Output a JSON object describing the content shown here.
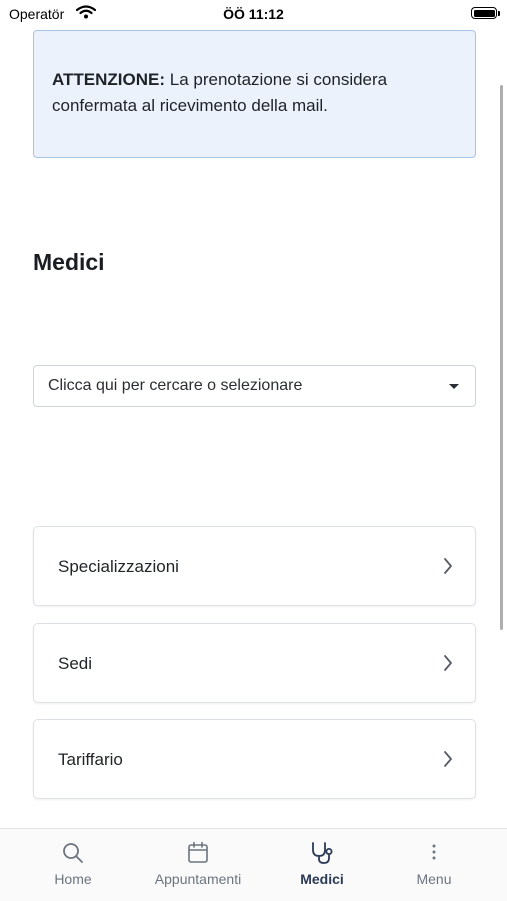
{
  "status_bar": {
    "carrier": "Operatör",
    "time": "ÖÖ 11:12"
  },
  "alert": {
    "title": "ATTENZIONE:",
    "message": "La prenotazione si considera confermata al ricevimento della mail."
  },
  "page": {
    "title": "Medici"
  },
  "search": {
    "placeholder": "Clicca qui per cercare o selezionare"
  },
  "menu": {
    "items": [
      {
        "label": "Specializzazioni"
      },
      {
        "label": "Sedi"
      },
      {
        "label": "Tariffario"
      }
    ]
  },
  "tabbar": {
    "tabs": [
      {
        "label": "Home",
        "icon": "search-icon"
      },
      {
        "label": "Appuntamenti",
        "icon": "calendar-icon"
      },
      {
        "label": "Medici",
        "icon": "stethoscope-icon",
        "active": true
      },
      {
        "label": "Menu",
        "icon": "more-vertical-icon"
      }
    ]
  },
  "colors": {
    "accent": "#2b3a55",
    "alert_bg": "#ecf2fb",
    "alert_border": "#a8c3e8"
  }
}
